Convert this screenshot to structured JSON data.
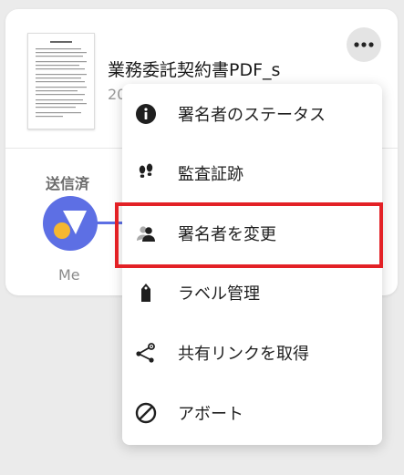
{
  "document": {
    "title": "業務委託契約書PDF_s",
    "date_fragment": "20"
  },
  "status": {
    "label": "送信済",
    "signer_label": "Me"
  },
  "menu": {
    "items": [
      {
        "label": "署名者のステータス",
        "icon": "info-icon"
      },
      {
        "label": "監査証跡",
        "icon": "footprints-icon"
      },
      {
        "label": "署名者を変更",
        "icon": "person-swap-icon"
      },
      {
        "label": "ラベル管理",
        "icon": "tag-icon"
      },
      {
        "label": "共有リンクを取得",
        "icon": "share-icon"
      },
      {
        "label": "アボート",
        "icon": "block-icon"
      }
    ]
  },
  "colors": {
    "accent": "#5d6fe4",
    "avatar_dot": "#f5b731",
    "highlight": "#e32126"
  }
}
